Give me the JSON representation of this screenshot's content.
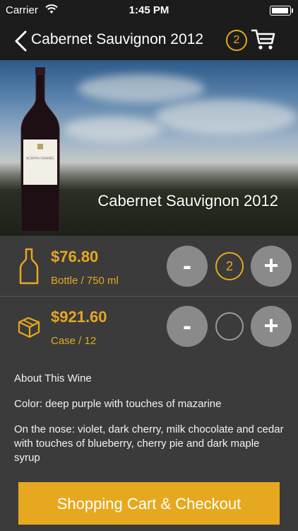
{
  "status_bar": {
    "carrier": "Carrier",
    "time": "1:45 PM",
    "battery_level": 0.95,
    "wifi_icon": "wifi-icon"
  },
  "nav": {
    "title": "Cabernet Sauvignon 2012",
    "cart_count": "2",
    "back_icon": "chevron-left-icon",
    "cart_icon": "cart-icon"
  },
  "hero": {
    "title": "Cabernet Sauvignon 2012",
    "bottle_label_text": "ACHITA CHAISEL"
  },
  "options": [
    {
      "price": "$76.80",
      "unit": "Bottle / 750 ml",
      "quantity": "2",
      "icon": "bottle-icon",
      "minus_label": "-",
      "plus_label": "+"
    },
    {
      "price": "$921.60",
      "unit": "Case / 12",
      "quantity": "",
      "icon": "box-icon",
      "minus_label": "-",
      "plus_label": "+"
    }
  ],
  "about": {
    "heading": "About This Wine",
    "color": "Color: deep purple with touches of mazarine",
    "nose": "On the nose: violet, dark cherry, milk chocolate and cedar with touches of blueberry, cherry pie and dark maple syrup"
  },
  "checkout_label": "Shopping Cart & Checkout",
  "colors": {
    "accent": "#e6a81f",
    "background": "#3b3b3b",
    "navbar": "#1c1c1c",
    "button_gray": "#8a8a8a"
  }
}
